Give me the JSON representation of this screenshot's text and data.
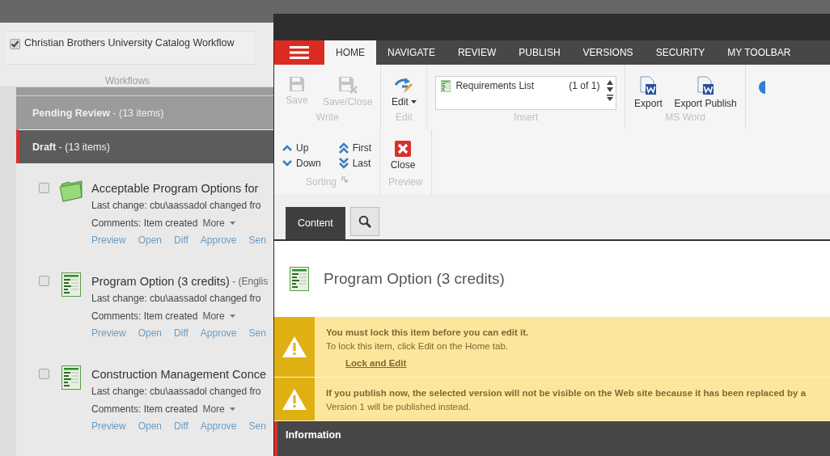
{
  "background_page": {
    "workflow_filter": {
      "label": "Christian Brothers University Catalog Workflow",
      "checked": true
    },
    "ribbon_group_label": "Workflows",
    "states": [
      {
        "name": "Pending Review",
        "count": " - (13 items)",
        "expanded": false
      },
      {
        "name": "Draft",
        "count": " - (13 items)",
        "expanded": true
      }
    ],
    "items": [
      {
        "kind": "folder",
        "checked": false,
        "title": "Acceptable Program Options for",
        "last_change": "Last change: cbu\\aassadol changed fro",
        "comments": "Comments: Item created",
        "more": "More",
        "actions": [
          "Preview",
          "Open",
          "Diff",
          "Approve",
          "Sen"
        ]
      },
      {
        "kind": "document",
        "checked": false,
        "title": "Program Option (3 credits)",
        "suffix": " - (Englis",
        "last_change": "Last change: cbu\\aassadol changed fro",
        "comments": "Comments: Item created",
        "more": "More",
        "actions": [
          "Preview",
          "Open",
          "Diff",
          "Approve",
          "Sen"
        ]
      },
      {
        "kind": "document",
        "checked": false,
        "title": "Construction Management Conce",
        "last_change": "Last change: cbu\\aassadol changed fro",
        "comments": "Comments: Item created",
        "more": "More",
        "actions": [
          "Preview",
          "Open",
          "Diff",
          "Approve",
          "Sen"
        ]
      }
    ]
  },
  "editor": {
    "tabs": [
      {
        "label": "HOME",
        "selected": true
      },
      {
        "label": "NAVIGATE",
        "selected": false
      },
      {
        "label": "REVIEW",
        "selected": false
      },
      {
        "label": "PUBLISH",
        "selected": false
      },
      {
        "label": "VERSIONS",
        "selected": false
      },
      {
        "label": "SECURITY",
        "selected": false
      },
      {
        "label": "MY TOOLBAR",
        "selected": false
      }
    ],
    "ribbon_rows": [
      [
        {
          "label": "Write",
          "buttons": [
            {
              "kind": "save",
              "label": "Save",
              "disabled": true
            },
            {
              "kind": "save-close",
              "label": "Save/Close",
              "disabled": true
            }
          ]
        },
        {
          "label": "Edit",
          "buttons": [
            {
              "kind": "edit",
              "label": "Edit",
              "disabled": false,
              "dropdown": true
            }
          ]
        },
        {
          "label": "Insert",
          "list": {
            "item": "Requirements List",
            "count": "(1 of 1)"
          }
        },
        {
          "label": "MS Word",
          "buttons": [
            {
              "kind": "word",
              "label": "Export",
              "disabled": false
            },
            {
              "kind": "word",
              "label": "Export Publish",
              "disabled": false
            }
          ]
        }
      ],
      [
        {
          "label": "Sorting",
          "launcher": true,
          "small_buttons": [
            {
              "kind": "up",
              "label": "Up"
            },
            {
              "kind": "first",
              "label": "First"
            },
            {
              "kind": "down",
              "label": "Down"
            },
            {
              "kind": "last",
              "label": "Last"
            }
          ]
        },
        {
          "label": "Preview",
          "buttons": [
            {
              "kind": "close",
              "label": "Close",
              "disabled": false
            }
          ]
        }
      ]
    ],
    "content_tab": {
      "label": "Content",
      "selected": true
    },
    "item_title": "Program Option (3 credits)",
    "warnings": [
      {
        "title": "You must lock this item before you can edit it.",
        "text": "To lock this item, click Edit on the Home tab.",
        "link": "Lock and Edit"
      },
      {
        "title": "If you publish now, the selected version will not be visible on the Web site because it has been replaced by a",
        "text": "Version 1 will be published instead."
      }
    ],
    "section": {
      "label": "Information",
      "selected": true
    }
  }
}
